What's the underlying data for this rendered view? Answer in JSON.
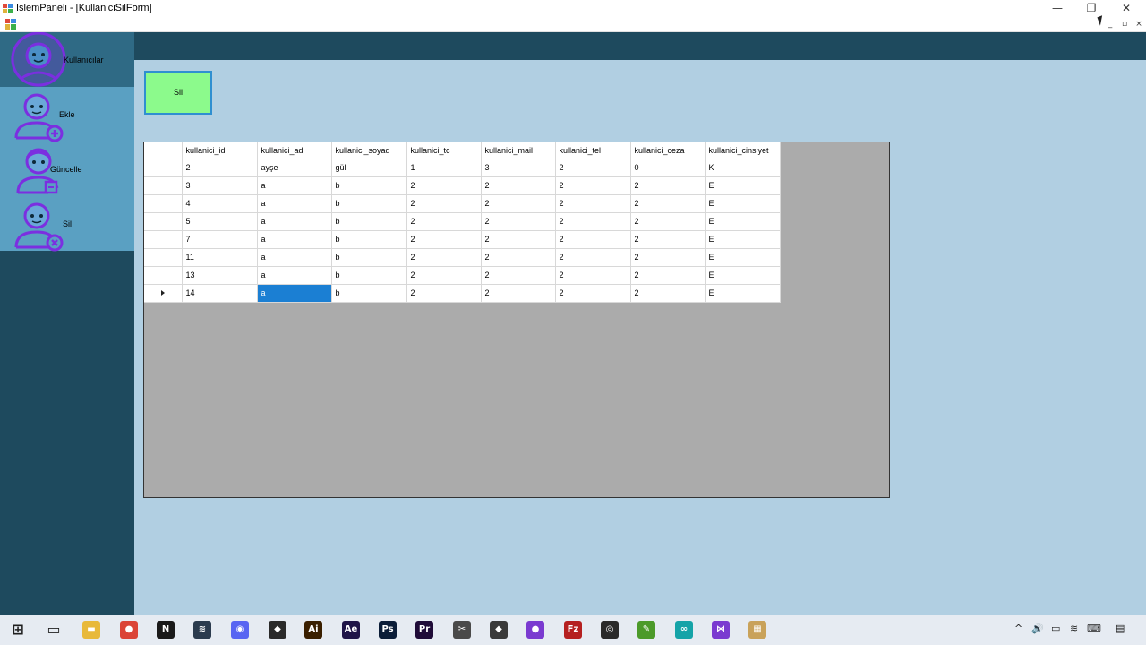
{
  "window": {
    "title": "IslemPaneli - [KullaniciSilForm]",
    "minimize_glyph": "—",
    "restore_glyph": "❐",
    "close_glyph": "✕"
  },
  "mdi_controls": {
    "minimize_glyph": "_",
    "restore_glyph": "▫",
    "close_glyph": "×"
  },
  "sidebar": {
    "items": [
      {
        "label": "Kullanıcılar",
        "icon": "user-avatar-icon",
        "active": true
      },
      {
        "label": "Ekle",
        "icon": "user-add-icon",
        "active": false
      },
      {
        "label": "Güncelle",
        "icon": "user-edit-icon",
        "active": false
      },
      {
        "label": "Sil",
        "icon": "user-delete-icon",
        "active": false
      }
    ]
  },
  "sil_button_label": "Sil",
  "grid": {
    "columns": [
      "kullanici_id",
      "kullanici_ad",
      "kullanici_soyad",
      "kullanici_tc",
      "kullanici_mail",
      "kullanici_tel",
      "kullanici_ceza",
      "kullanici_cinsiyet"
    ],
    "rows": [
      [
        "2",
        "ayşe",
        "gül",
        "1",
        "3",
        "2",
        "0",
        "K"
      ],
      [
        "3",
        "a",
        "b",
        "2",
        "2",
        "2",
        "2",
        "E"
      ],
      [
        "4",
        "a",
        "b",
        "2",
        "2",
        "2",
        "2",
        "E"
      ],
      [
        "5",
        "a",
        "b",
        "2",
        "2",
        "2",
        "2",
        "E"
      ],
      [
        "7",
        "a",
        "b",
        "2",
        "2",
        "2",
        "2",
        "E"
      ],
      [
        "11",
        "a",
        "b",
        "2",
        "2",
        "2",
        "2",
        "E"
      ],
      [
        "13",
        "a",
        "b",
        "2",
        "2",
        "2",
        "2",
        "E"
      ],
      [
        "14",
        "a",
        "b",
        "2",
        "2",
        "2",
        "2",
        "E"
      ]
    ],
    "current_row": 7,
    "selected_cell": {
      "row": 7,
      "col": 1
    }
  },
  "taskbar": {
    "apps": [
      {
        "name": "windows-start-icon",
        "glyph": "⊞",
        "color": "#1f1f1f"
      },
      {
        "name": "task-view-icon",
        "glyph": "▭",
        "color": "#1f1f1f"
      },
      {
        "name": "file-explorer-icon",
        "glyph": "▬",
        "color": "#e8b93a"
      },
      {
        "name": "chrome-icon",
        "glyph": "●",
        "color": "#db4437"
      },
      {
        "name": "netflix-icon",
        "glyph": "N",
        "color": "#1a1a1a"
      },
      {
        "name": "monitor-app-icon",
        "glyph": "≋",
        "color": "#2b3b4e"
      },
      {
        "name": "discord-icon",
        "glyph": "◉",
        "color": "#5865f2"
      },
      {
        "name": "unity-icon",
        "glyph": "◆",
        "color": "#2a2a2a"
      },
      {
        "name": "illustrator-icon",
        "glyph": "Ai",
        "color": "#3a1f00"
      },
      {
        "name": "after-effects-icon",
        "glyph": "Ae",
        "color": "#1f1447"
      },
      {
        "name": "photoshop-icon",
        "glyph": "Ps",
        "color": "#0b1d38"
      },
      {
        "name": "premiere-icon",
        "glyph": "Pr",
        "color": "#1f0b38"
      },
      {
        "name": "tools-icon",
        "glyph": "✂",
        "color": "#4a4a4a"
      },
      {
        "name": "git-icon",
        "glyph": "◆",
        "color": "#3a3a3a"
      },
      {
        "name": "github-icon",
        "glyph": "●",
        "color": "#7a3ad0"
      },
      {
        "name": "filezilla-icon",
        "glyph": "Fz",
        "color": "#b52020"
      },
      {
        "name": "obs-icon",
        "glyph": "◎",
        "color": "#2a2a2a"
      },
      {
        "name": "notepad-plus-icon",
        "glyph": "✎",
        "color": "#4c9a2a"
      },
      {
        "name": "arduino-icon",
        "glyph": "∞",
        "color": "#15a3a8"
      },
      {
        "name": "visual-studio-icon",
        "glyph": "⋈",
        "color": "#7a3ad0"
      },
      {
        "name": "winforms-app-icon",
        "glyph": "▦",
        "color": "#c9a25a"
      }
    ],
    "tray": [
      {
        "name": "tray-chevron-icon",
        "glyph": "^"
      },
      {
        "name": "volume-icon",
        "glyph": "🔊"
      },
      {
        "name": "battery-icon",
        "glyph": "▭"
      },
      {
        "name": "wifi-icon",
        "glyph": "≋"
      },
      {
        "name": "keyboard-icon",
        "glyph": "⌨"
      },
      {
        "name": "notifications-icon",
        "glyph": "▤"
      }
    ]
  }
}
